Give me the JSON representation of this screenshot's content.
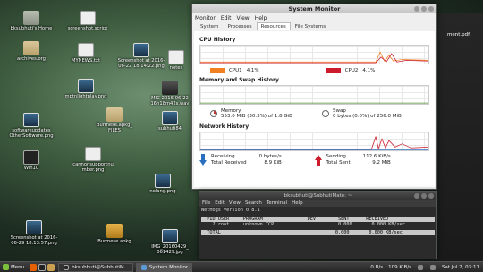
{
  "desktop_icons": [
    {
      "label": "bksubhuti's Home",
      "kind": "folder-g"
    },
    {
      "label": "screenshot.script",
      "kind": "doc"
    },
    {
      "label": "archives.org",
      "kind": "folder"
    },
    {
      "label": "MYNEWS.txt",
      "kind": "doc"
    },
    {
      "label": "Screenshot at 2016-\n06-22 18:14:22.png",
      "kind": "image"
    },
    {
      "label": "notes",
      "kind": "doc"
    },
    {
      "label": "mptnlightplay.png",
      "kind": "image"
    },
    {
      "label": "MIC-2016-06-22\n16h18m42s.wav",
      "kind": "audio"
    },
    {
      "label": "softwareupdates\nOtherSoftware.png",
      "kind": "image"
    },
    {
      "label": "Burmese.apkg_\nFILES",
      "kind": "folder"
    },
    {
      "label": "subhuti84",
      "kind": "image"
    },
    {
      "label": "Win10",
      "kind": "term"
    },
    {
      "label": "cannonsupportnu\nmber.png",
      "kind": "doc"
    },
    {
      "label": "nolang.png",
      "kind": "image"
    },
    {
      "label": "Screenshot at 2016-\n06-29 18:13:57.png",
      "kind": "image"
    },
    {
      "label": "Burmese.apkg",
      "kind": "pkg"
    },
    {
      "label": "IMG_20160429_\n061429.jpg",
      "kind": "image"
    }
  ],
  "right_window": {
    "label": "ment.pdf"
  },
  "sysmon": {
    "title": "System Monitor",
    "menu": [
      "Monitor",
      "Edit",
      "View",
      "Help"
    ],
    "tabs": [
      "System",
      "Processes",
      "Resources",
      "File Systems"
    ],
    "active_tab": "Resources",
    "cpu": {
      "title": "CPU History",
      "cpu1_label": "CPU1",
      "cpu1_value": "4.1%",
      "cpu1_color": "#f08020",
      "cpu2_label": "CPU2",
      "cpu2_value": "4.1%",
      "cpu2_color": "#cc1c2c"
    },
    "memory": {
      "title": "Memory and Swap History",
      "mem_label": "Memory",
      "mem_value": "553.0 MiB (30.3%) of 1.8 GiB",
      "mem_fraction": 0.303,
      "swap_label": "Swap",
      "swap_value": "0 bytes (0.0%) of 256.0 MiB"
    },
    "network": {
      "title": "Network History",
      "receiving_label": "Receiving",
      "receiving_value": "0 bytes/s",
      "total_received_label": "Total Received",
      "total_received_value": "8.9 KiB",
      "sending_label": "Sending",
      "sending_value": "112.6 KiB/s",
      "total_sent_label": "Total Sent",
      "total_sent_value": "9.2 MiB"
    }
  },
  "terminal": {
    "title": "bksubhuti@SubhutiMate: ~",
    "menu": [
      "File",
      "Edit",
      "View",
      "Search",
      "Terminal",
      "Help"
    ],
    "version_line": "NetHogs version 0.8.1",
    "header_line": "  PID USER     PROGRAM                DEV        SENT      RECEIVED",
    "row_line": "    ? root     unknown TCP                       0.000       0.000 KB/sec",
    "total_line": "  TOTAL                                         0.000       0.000 KB/sec"
  },
  "taskbar": {
    "menu_label": "Menu",
    "tasks": [
      "bksubhuti@SubhutiM...",
      "System Monitor"
    ],
    "active_task": "System Monitor",
    "tray_items": [
      "0 B/s",
      "109 KiB/s"
    ],
    "clock": "Sat Jul 2, 03:11"
  }
}
